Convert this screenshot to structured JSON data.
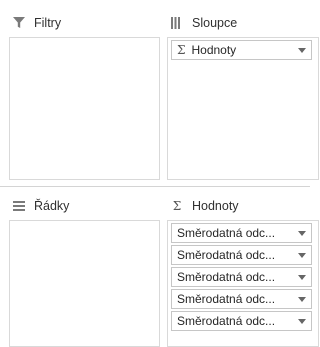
{
  "filters": {
    "title": "Filtry",
    "icon": "filter-icon"
  },
  "columns": {
    "title": "Sloupce",
    "icon": "columns-icon",
    "items": [
      {
        "sigma": "Σ",
        "label": "Hodnoty"
      }
    ]
  },
  "rows": {
    "title": "Řádky",
    "icon": "rows-icon"
  },
  "values": {
    "title": "Hodnoty",
    "sigma": "Σ",
    "items": [
      {
        "label": "Směrodatná odc..."
      },
      {
        "label": "Směrodatná odc..."
      },
      {
        "label": "Směrodatná odc..."
      },
      {
        "label": "Směrodatná odc..."
      },
      {
        "label": "Směrodatná odc..."
      }
    ]
  },
  "colors": {
    "border": "#d9d9d9",
    "icon": "#7a7a7a"
  }
}
